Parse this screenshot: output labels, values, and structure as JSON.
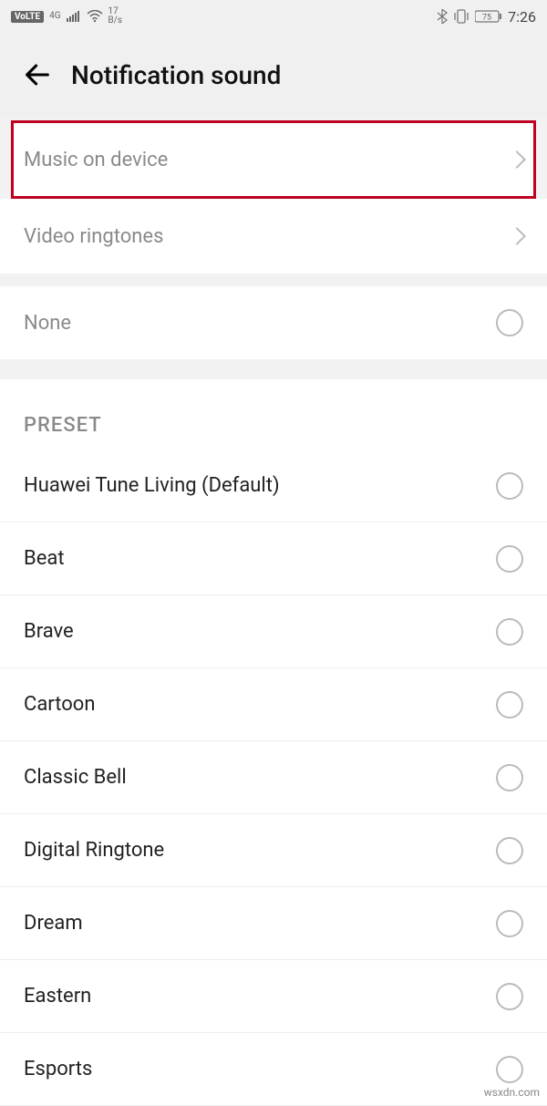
{
  "status_bar": {
    "volte": "VoLTE",
    "net1": "4G",
    "speed_top": "17",
    "speed_bot": "B/s",
    "battery": "75",
    "time": "7:26"
  },
  "header": {
    "title": "Notification sound"
  },
  "nav_items": [
    {
      "label": "Music on device",
      "highlight": true
    },
    {
      "label": "Video ringtones",
      "highlight": false
    }
  ],
  "none_label": "None",
  "preset_header": "PRESET",
  "presets": [
    "Huawei Tune Living (Default)",
    "Beat",
    "Brave",
    "Cartoon",
    "Classic Bell",
    "Digital Ringtone",
    "Dream",
    "Eastern",
    "Esports"
  ],
  "watermark": "wsxdn.com"
}
